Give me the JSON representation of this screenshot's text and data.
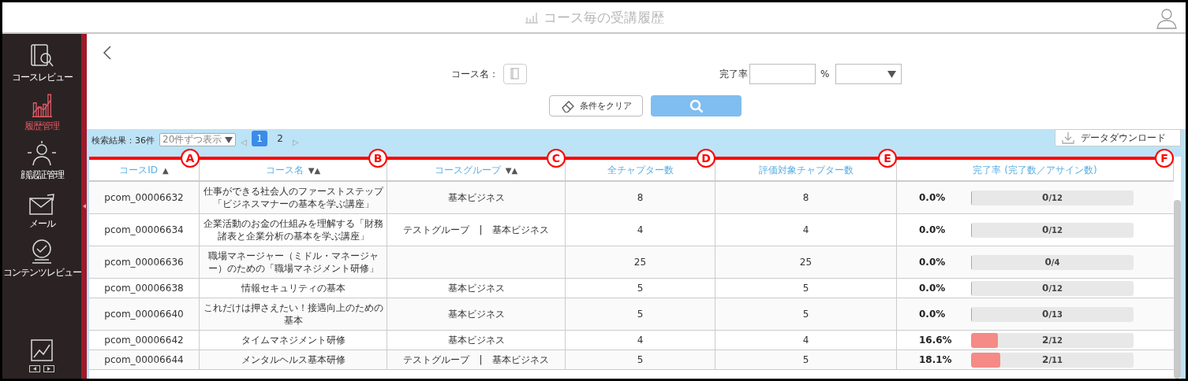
{
  "header": {
    "title": "コース毎の受講履歴"
  },
  "sidebar": {
    "items": [
      {
        "label": "コースレビュー",
        "kind": "book",
        "selected": false
      },
      {
        "label": "履歴管理",
        "kind": "chart",
        "selected": true
      },
      {
        "label": "顔認証管理",
        "kind": "face",
        "selected": false
      },
      {
        "label": "メール",
        "kind": "mail",
        "selected": false
      },
      {
        "label": "コンテンツレビュー",
        "kind": "badge",
        "selected": false
      }
    ]
  },
  "search": {
    "course_label": "コース名：",
    "rate_label": "完了率",
    "rate_unit": "%",
    "clear_button": "条件をクリア"
  },
  "results": {
    "summary": "検索結果：36件",
    "per_page": "20件ずつ表示",
    "prev": "◁",
    "next": "▷",
    "pages": [
      {
        "label": "1",
        "selected": true
      },
      {
        "label": "2",
        "selected": false
      }
    ],
    "download_button": "データダウンロード"
  },
  "table": {
    "columns": [
      {
        "label": "コースID",
        "sort": "▲",
        "marker": "A"
      },
      {
        "label": "コース名",
        "sort": "▼▲",
        "marker": "B"
      },
      {
        "label": "コースグループ",
        "sort": "▼▲",
        "marker": "C"
      },
      {
        "label": "全チャプター数",
        "marker": "D"
      },
      {
        "label": "評価対象チャプター数",
        "marker": "E"
      },
      {
        "label": "完了率 (完了数／アサイン数)",
        "marker": "F"
      }
    ],
    "rows": [
      {
        "id": "pcom_00006632",
        "name": "仕事ができる社会人のファーストステップ「ビジネスマナーの基本を学ぶ講座」",
        "group": "基本ビジネス",
        "chapters": "8",
        "evaluated": "8",
        "rate": "0.0%",
        "done": "0",
        "assigned": "/12",
        "level": 0
      },
      {
        "id": "pcom_00006634",
        "name": "企業活動のお金の仕組みを理解する「財務諸表と企業分析の基本を学ぶ講座」",
        "group": "テストグループ　|　基本ビジネス",
        "chapters": "4",
        "evaluated": "4",
        "rate": "0.0%",
        "done": "0",
        "assigned": "/12",
        "level": 0
      },
      {
        "id": "pcom_00006636",
        "name": "職場マネージャー（ミドル・マネージャー）のための「職場マネジメント研修」",
        "chapters": "25",
        "evaluated": "25",
        "rate": "0.0%",
        "done": "0",
        "assigned": "/4",
        "level": 0
      },
      {
        "id": "pcom_00006638",
        "name": "情報セキュリティの基本",
        "group": "基本ビジネス",
        "chapters": "5",
        "evaluated": "5",
        "rate": "0.0%",
        "done": "0",
        "assigned": "/12",
        "level": 0
      },
      {
        "id": "pcom_00006640",
        "name": "これだけは押さえたい！接遇向上のための基本",
        "group": "基本ビジネス",
        "chapters": "5",
        "evaluated": "5",
        "rate": "0.0%",
        "done": "0",
        "assigned": "/13",
        "level": 0
      },
      {
        "id": "pcom_00006642",
        "name": "タイムマネジメント研修",
        "group": "基本ビジネス",
        "chapters": "4",
        "evaluated": "4",
        "rate": "16.6%",
        "done": "2",
        "assigned": "/12",
        "level": 0.166
      },
      {
        "id": "pcom_00006644",
        "name": "メンタルヘルス基本研修",
        "group": "テストグループ　|　基本ビジネス",
        "chapters": "5",
        "evaluated": "5",
        "rate": "18.1%",
        "done": "2",
        "assigned": "/11",
        "level": 0.181
      }
    ]
  }
}
